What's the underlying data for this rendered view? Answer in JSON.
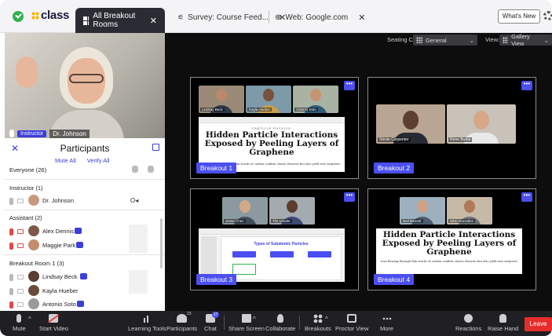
{
  "brand": {
    "logo": "class"
  },
  "tabs": [
    {
      "label": "All Breakout Rooms",
      "active": true
    },
    {
      "label": "Survey: Course Feed...",
      "active": false
    },
    {
      "label": "Web: Google.com",
      "active": false
    }
  ],
  "header": {
    "whats_new": "What's New"
  },
  "instructor_video": {
    "badge": "Instructor",
    "name": "Dr. Johnson"
  },
  "participants": {
    "title": "Participants",
    "mute_all": "Mute All",
    "verify_all": "Verify All",
    "everyone": "Everyone (26)",
    "sections": [
      {
        "label": "Instructor (1)",
        "members": [
          {
            "name": "Dr. Johnson"
          }
        ]
      },
      {
        "label": "Assistant (2)",
        "members": [
          {
            "name": "Alex Dennis"
          },
          {
            "name": "Maggie Park"
          }
        ]
      },
      {
        "label": "Breakout Room 1 (3)",
        "members": [
          {
            "name": "Lindsay Beck"
          },
          {
            "name": "Kayla Hueber"
          },
          {
            "name": "Antonio Soto"
          }
        ]
      }
    ]
  },
  "toolbar_top": {
    "seating_label": "Seating Chart:",
    "seating_value": "General",
    "view_label": "View:",
    "view_value": "Gallery View"
  },
  "rooms": [
    {
      "label": "Breakout 1",
      "people": [
        "Lindsay Beck",
        "Kayla Hueber",
        "Antonio Soto"
      ],
      "doc_title": "Hidden Particle Interactions Exposed by Peeling Layers of Graphene",
      "doc_tag": "PARTICLE PHYSICS",
      "doc_sub": "Ions flowing through thin stacks of carbon confirm classic theories but also yield new surprises"
    },
    {
      "label": "Breakout 2",
      "people": [
        "Stevie Carpenter",
        "Rene Burke"
      ]
    },
    {
      "label": "Breakout 3",
      "people": [
        "Jesse Chen",
        "Tim Lander"
      ],
      "slide_title": "Types of Subatomic Particles"
    },
    {
      "label": "Breakout 4",
      "people": [
        "Neil Barnett",
        "Nikki Gonzalez"
      ],
      "doc_title": "Hidden Particle Interactions Exposed by Peeling Layers of Graphene",
      "doc_sub": "Ions flowing through thin stacks of carbon confirm classic theories but also yield new surprises"
    }
  ],
  "more_label": "•••",
  "bottom": {
    "mute": "Mute",
    "start_video": "Start Video",
    "learning_tools": "Learning Tools",
    "participants": "Participants",
    "participants_count": "23",
    "chat": "Chat",
    "chat_count": "17",
    "share_screen": "Share Screen",
    "collaborate": "Collaborate",
    "breakouts": "Breakouts",
    "proctor_view": "Proctor View",
    "more": "More",
    "reactions": "Reactions",
    "raise_hand": "Raise Hand",
    "leave": "Leave"
  },
  "colors": {
    "accent": "#4b4ff0",
    "leave": "#e62d2d",
    "dark": "#1f1f24"
  }
}
